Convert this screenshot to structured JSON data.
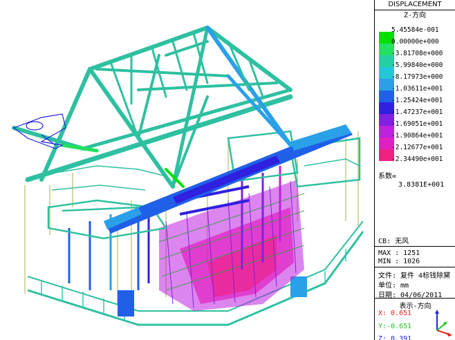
{
  "panel": {
    "title": "DISPLACEMENT",
    "component": "Z-方向",
    "legend": [
      {
        "value": "5.45584e-001",
        "color": "#00e000"
      },
      {
        "value": "0.00000e+000",
        "color": "#22e060"
      },
      {
        "value": "-3.81708e+000",
        "color": "#22d0a0"
      },
      {
        "value": "-5.99840e+000",
        "color": "#22c8d8"
      },
      {
        "value": "-8.17973e+000",
        "color": "#2aa0e8"
      },
      {
        "value": "-1.03611e+001",
        "color": "#2060e8"
      },
      {
        "value": "-1.25424e+001",
        "color": "#3020e0"
      },
      {
        "value": "-1.47237e+001",
        "color": "#8020e0"
      },
      {
        "value": "-1.69051e+001",
        "color": "#c020e0"
      },
      {
        "value": "-1.90864e+001",
        "color": "#e020c0"
      },
      {
        "value": "-2.12677e+001",
        "color": "#f02080"
      },
      {
        "value": "-2.34490e+001",
        "color": "#e82030"
      }
    ],
    "coef_label": "系数=",
    "coef_value": "3.8381E+001",
    "cb": "CB: 无风",
    "max": "MAX : 1251",
    "min": "MIN : 1026",
    "file": "文件: 复件 4标钱除黛",
    "unit": "单位: mm",
    "date": "日期: 04/06/2011",
    "view_title": "表示-方向",
    "x_axis": "X: 0.651",
    "y_axis": "Y:-0.651",
    "z_axis": "Z: 0.391",
    "axis_colors": {
      "x": "#e02020",
      "y": "#20c020",
      "z": "#2020e0"
    },
    "triad_icon": "axis-triad-icon"
  }
}
